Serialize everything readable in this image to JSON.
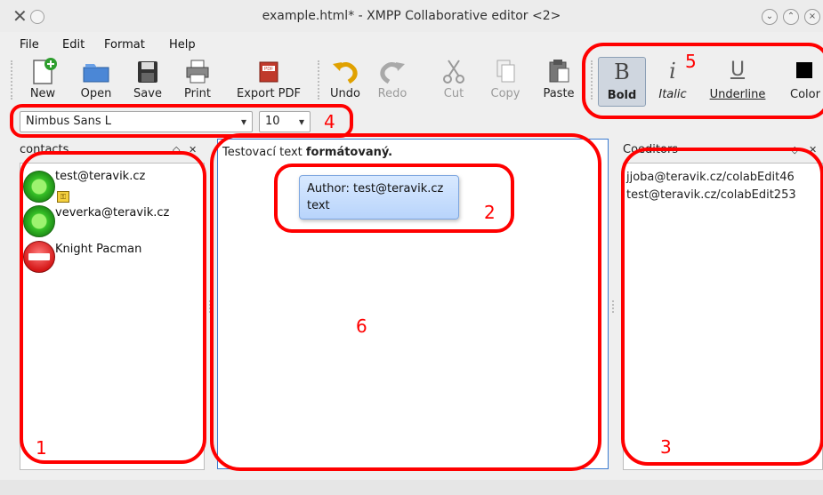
{
  "window": {
    "title": "example.html* - XMPP Collaborative editor <2>",
    "buttons": {
      "minimize": "⌄",
      "maximize": "⌃",
      "close": "×"
    }
  },
  "menu": [
    "File",
    "Edit",
    "Format",
    "Help"
  ],
  "toolbar": {
    "new": "New",
    "open": "Open",
    "save": "Save",
    "print": "Print",
    "export_pdf": "Export PDF",
    "undo": "Undo",
    "redo": "Redo",
    "cut": "Cut",
    "copy": "Copy",
    "paste": "Paste",
    "bold": "Bold",
    "italic": "Italic",
    "underline": "Underline",
    "color": "Color",
    "pdf_icon_text": "PDF"
  },
  "font_bar": {
    "font": "Nimbus Sans L",
    "size": "10"
  },
  "contacts": {
    "title": "contacts",
    "items": [
      {
        "name": "test@teravik.cz",
        "status": "online"
      },
      {
        "name": "veverka@teravik.cz",
        "status": "online"
      },
      {
        "name": "Knight Pacman",
        "status": "busy"
      }
    ]
  },
  "editor": {
    "text_plain": "Testovací text ",
    "text_bold": "formátovaný.",
    "tooltip_line1": "Author: test@teravik.cz",
    "tooltip_line2": "text"
  },
  "coeditors": {
    "title": "Coeditors",
    "items": [
      "jjoba@teravik.cz/colabEdit46",
      "test@teravik.cz/colabEdit253"
    ]
  },
  "annotations": {
    "one": "1",
    "two": "2",
    "three": "3",
    "four": "4",
    "five": "5",
    "six": "6"
  },
  "colors": {
    "annotation": "#ff0000",
    "editor_border": "#3b7bd0",
    "tooltip": "#c8ddfb"
  }
}
